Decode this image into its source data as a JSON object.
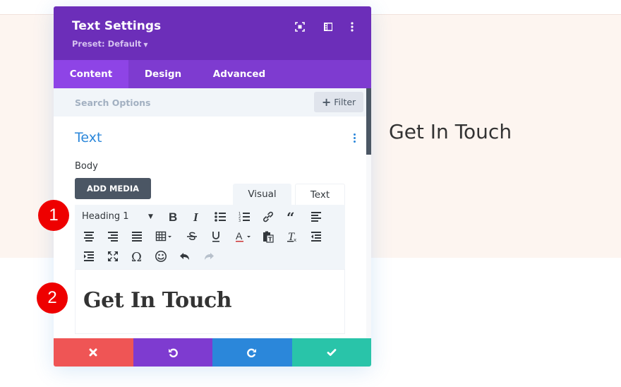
{
  "page": {
    "hero_heading": "Get In Touch",
    "colors": {
      "hero_bg": "#fdf5f0",
      "header_bg": "#6c2eb9",
      "tabs_bg": "#7e3bd0",
      "active_tab_bg": "#8e44e6",
      "accent_blue": "#2b87da",
      "cancel": "#ef5555",
      "undo": "#7e3bd0",
      "redo": "#2b87da",
      "save": "#29c4a9",
      "badge": "#ee0000"
    }
  },
  "annotations": [
    {
      "label": "1"
    },
    {
      "label": "2"
    }
  ],
  "modal": {
    "title": "Text Settings",
    "preset": "Preset: Default",
    "header_icons": [
      "expand-icon",
      "columns-icon",
      "more-vertical-icon"
    ],
    "tabs": [
      {
        "label": "Content",
        "active": true
      },
      {
        "label": "Design",
        "active": false
      },
      {
        "label": "Advanced",
        "active": false
      }
    ],
    "search": {
      "placeholder": "Search Options"
    },
    "filter_label": "Filter",
    "section": {
      "title": "Text",
      "body_label": "Body",
      "add_media_label": "ADD MEDIA",
      "editor_tabs": [
        {
          "label": "Visual",
          "active": true
        },
        {
          "label": "Text",
          "active": false
        }
      ],
      "format_select": "Heading 1",
      "toolbar_icons": [
        "bold-icon",
        "italic-icon",
        "bullet-list-icon",
        "numbered-list-icon",
        "link-icon",
        "blockquote-icon",
        "align-left-icon",
        "align-center-icon",
        "align-right-icon",
        "align-justify-icon",
        "table-icon",
        "strikethrough-icon",
        "underline-icon",
        "text-color-icon",
        "paste-text-icon",
        "clear-formatting-icon",
        "outdent-icon",
        "indent-icon",
        "fullscreen-icon",
        "special-character-icon",
        "emoji-icon",
        "undo-icon",
        "redo-icon"
      ],
      "editor_content": "Get In Touch"
    },
    "footer": {
      "cancel": "cancel",
      "undo": "undo",
      "redo": "redo",
      "save": "save"
    }
  }
}
